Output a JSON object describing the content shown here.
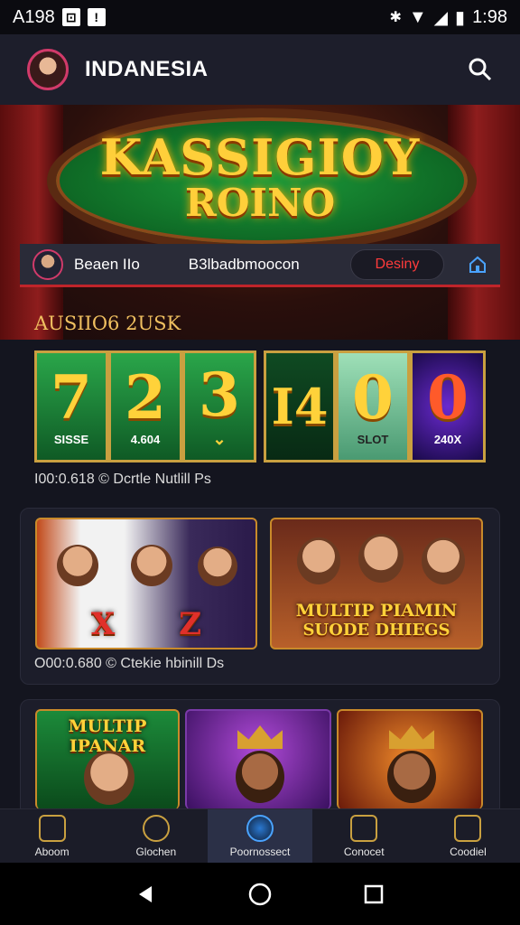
{
  "status_bar": {
    "left_text": "A198",
    "time": "1:98"
  },
  "app_bar": {
    "title": "INDANESIA"
  },
  "hero": {
    "logo_line1": "KASSIGIOY",
    "logo_line2": "ROINO"
  },
  "user_bar": {
    "username": "Beaen IIo",
    "balance": "B3lbadbmoocon",
    "deposit_label": "Desiny"
  },
  "section": {
    "title": "AUSIIO6 2USK"
  },
  "reels": [
    {
      "value": "7",
      "label": "SISSE",
      "theme": "green"
    },
    {
      "value": "2",
      "label": "4.604",
      "theme": "green"
    },
    {
      "value": "3",
      "label": "",
      "theme": "green"
    },
    {
      "value": "I4",
      "label": "",
      "theme": "darkgreen"
    },
    {
      "value": "0",
      "label": "SLOT",
      "theme": "mint"
    },
    {
      "value": "0",
      "label": "240X",
      "theme": "purple"
    }
  ],
  "meta1": "I00:0.618 © Dcrtle Nutlill Ps",
  "meta2": "O00:0.680 © Ctekie hbinill Ds",
  "cards": {
    "slot_card_symbols": [
      "X",
      "Z"
    ],
    "promo_title_line1": "MULTIP PIAMIN",
    "promo_title_line2": "SUODE DHIEGS",
    "game_row_label": "MULTIP IPANAR"
  },
  "bottom_nav": [
    {
      "label": "Aboom",
      "icon": "home-icon"
    },
    {
      "label": "Glochen",
      "icon": "triangle-icon"
    },
    {
      "label": "Poornossect",
      "icon": "globe-icon"
    },
    {
      "label": "Conocet",
      "icon": "bag-icon"
    },
    {
      "label": "Coodiel",
      "icon": "chest-icon"
    }
  ]
}
